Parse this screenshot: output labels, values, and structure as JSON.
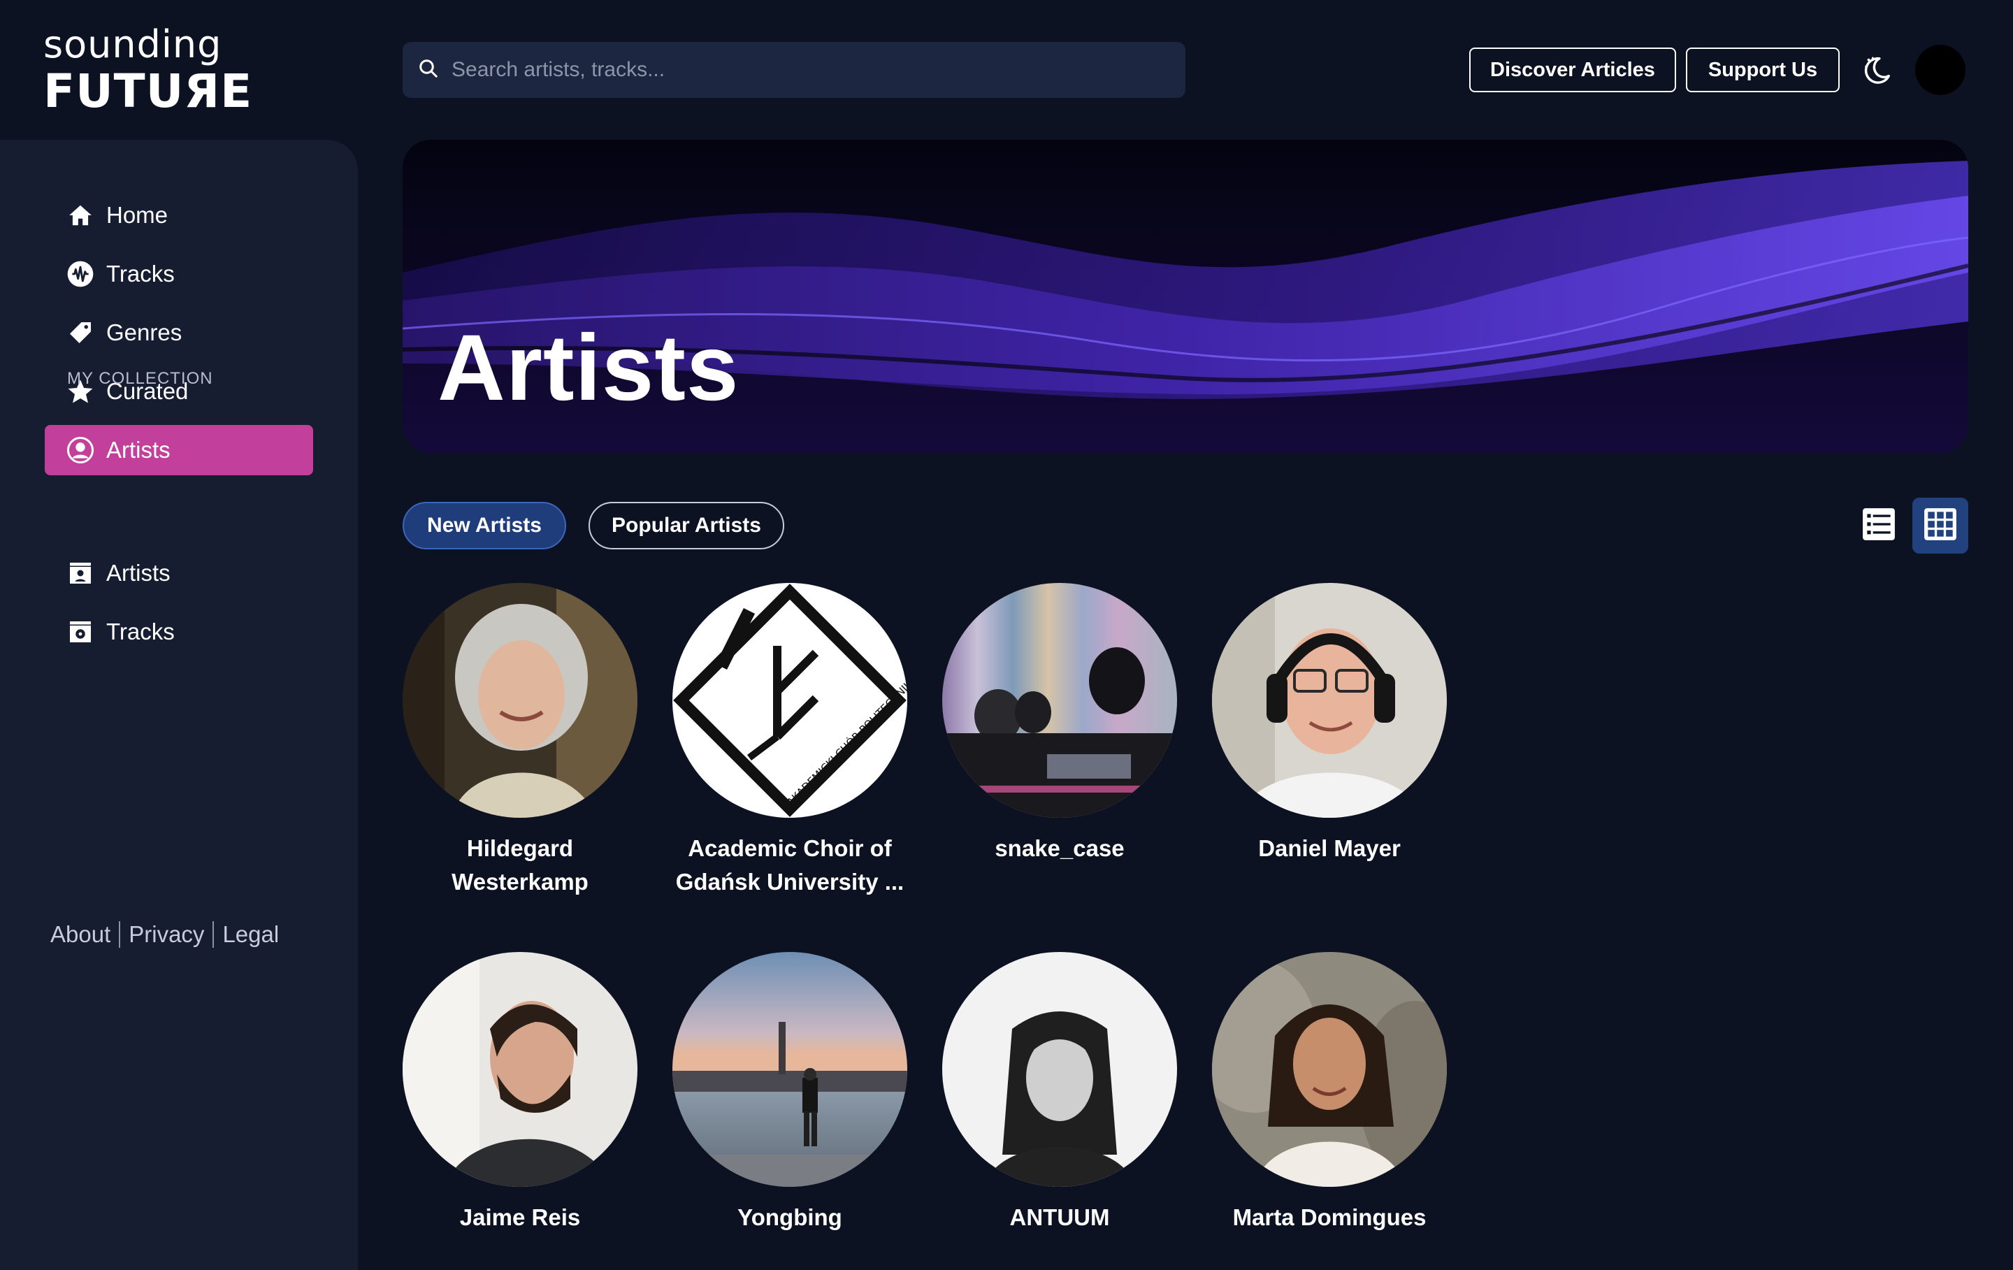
{
  "logo": {
    "line1": "sounding",
    "line2": "FUTUЯE"
  },
  "search": {
    "placeholder": "Search artists, tracks..."
  },
  "header": {
    "discover_label": "Discover Articles",
    "support_label": "Support Us"
  },
  "sidebar": {
    "items": [
      {
        "label": "Home",
        "icon": "home-icon"
      },
      {
        "label": "Tracks",
        "icon": "waveform-icon"
      },
      {
        "label": "Genres",
        "icon": "tag-icon"
      },
      {
        "label": "Curated",
        "icon": "star-icon"
      },
      {
        "label": "Artists",
        "icon": "user-circle-icon",
        "active": true
      }
    ],
    "collection_label": "MY COLLECTION",
    "collection_items": [
      {
        "label": "Artists",
        "icon": "artist-box-icon"
      },
      {
        "label": "Tracks",
        "icon": "music-box-icon"
      }
    ],
    "footer": {
      "about": "About",
      "privacy": "Privacy",
      "legal": "Legal"
    }
  },
  "banner": {
    "title": "Artists"
  },
  "filters": {
    "new_label": "New Artists",
    "popular_label": "Popular Artists",
    "active": "New Artists"
  },
  "view_mode": "grid",
  "artists": [
    {
      "name_line1": "Hildegard",
      "name_line2": "Westerkamp"
    },
    {
      "name_line1": "Academic Choir of",
      "name_line2": "Gdańsk University ...",
      "logo_text": "AKADEMICKI CHÓR POLITECHNIKI GDAŃSKIEJ"
    },
    {
      "name_line1": "snake_case",
      "name_line2": ""
    },
    {
      "name_line1": "Daniel Mayer",
      "name_line2": ""
    },
    {
      "name_line1": "Jaime Reis",
      "name_line2": ""
    },
    {
      "name_line1": "Yongbing",
      "name_line2": ""
    },
    {
      "name_line1": "ANTUUM",
      "name_line2": ""
    },
    {
      "name_line1": "Marta Domingues",
      "name_line2": ""
    }
  ],
  "colors": {
    "background": "#0d1222",
    "sidebar": "#161d31",
    "accent_active_nav": "#c2409c",
    "active_pill": "#1f3d7a",
    "active_view": "#21427e"
  }
}
